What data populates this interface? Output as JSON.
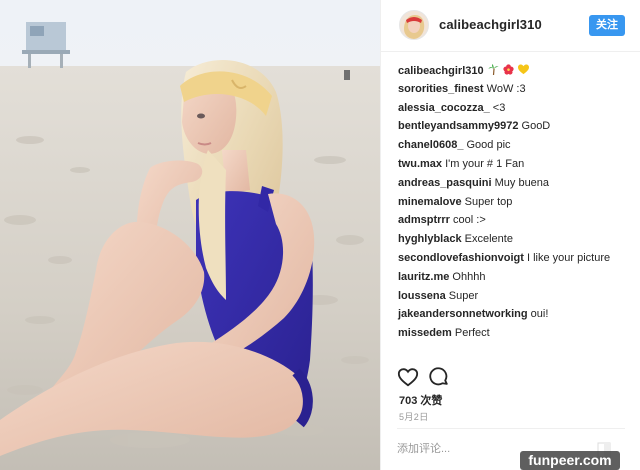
{
  "header": {
    "username": "calibeachgirl310",
    "follow_label": "关注"
  },
  "comments": [
    {
      "user": "calibeachgirl310",
      "text": ""
    },
    {
      "user": "sororities_finest",
      "text": "WoW :3"
    },
    {
      "user": "alessia_cocozza_",
      "text": "<3"
    },
    {
      "user": "bentleyandsammy9972",
      "text": "GooD"
    },
    {
      "user": "chanel0608_",
      "text": "Good pic"
    },
    {
      "user": "twu.max",
      "text": "I'm your # 1 Fan"
    },
    {
      "user": "andreas_pasquini",
      "text": "Muy buena"
    },
    {
      "user": "minemalove",
      "text": "Super top"
    },
    {
      "user": "admsptrrr",
      "text": "cool :>"
    },
    {
      "user": "hyghlyblack",
      "text": "Excelente"
    },
    {
      "user": "secondlovefashionvoigt",
      "text": "I like your picture"
    },
    {
      "user": "lauritz.me",
      "text": "Ohhhh"
    },
    {
      "user": "loussena",
      "text": "Super"
    },
    {
      "user": "jakeandersonnetworking",
      "text": "oui!"
    },
    {
      "user": "missedem",
      "text": "Perfect"
    }
  ],
  "caption_emojis": [
    "palm-tree-emoji",
    "hibiscus-emoji",
    "yellow-heart-emoji"
  ],
  "stats": {
    "likes": "703 次赞",
    "date": "5月2日"
  },
  "comment_box": {
    "placeholder": "添加评论..."
  },
  "watermark": "funpeer.com",
  "colors": {
    "accent": "#3897f0",
    "text": "#262626",
    "muted": "#999999",
    "swimsuit": "#3a2fb0",
    "headband": "#f0d38c"
  }
}
